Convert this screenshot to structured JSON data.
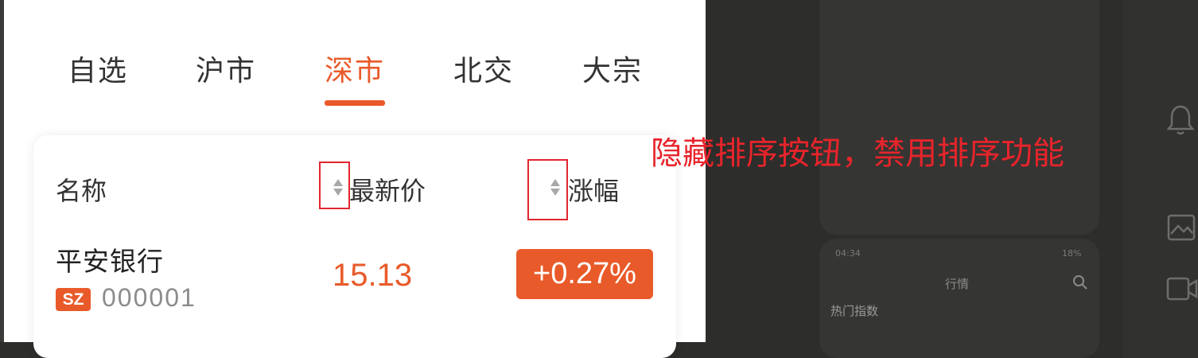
{
  "tabs": [
    {
      "label": "自选"
    },
    {
      "label": "沪市"
    },
    {
      "label": "深市",
      "active": true
    },
    {
      "label": "北交"
    },
    {
      "label": "大宗"
    }
  ],
  "table": {
    "headers": {
      "name": "名称",
      "price": "最新价",
      "change": "涨幅"
    },
    "rows": [
      {
        "name": "平安银行",
        "market": "SZ",
        "code": "000001",
        "price": "15.13",
        "change": "+0.27%"
      }
    ]
  },
  "annotation": "隐藏排序按钮，禁用排序功能",
  "background_panel": {
    "status_time": "04:34",
    "status_battery": "18%",
    "title": "行情",
    "section": "热门指数"
  },
  "colors": {
    "accent": "#e95a2a",
    "annotation": "#e8242b",
    "overlay": "#2d2d2b"
  },
  "icons": [
    "sort-arrows-icon",
    "bell-icon",
    "image-icon",
    "video-icon",
    "search-icon"
  ]
}
